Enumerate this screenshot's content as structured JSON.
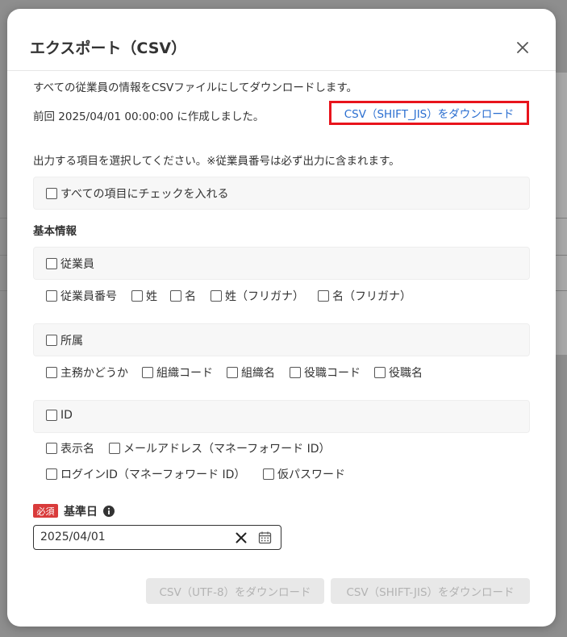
{
  "modal": {
    "title": "エクスポート（CSV）",
    "description": "すべての従業員の情報をCSVファイルにしてダウンロードします。",
    "previous": "前回 2025/04/01 00:00:00 に作成しました。",
    "previous_download_link": "CSV（SHIFT_JIS）をダウンロード",
    "select_instruction": "出力する項目を選択してください。※従業員番号は必ず出力に含まれます。"
  },
  "select_all": {
    "label": "すべての項目にチェックを入れる",
    "checked": false
  },
  "basic_info": {
    "heading": "基本情報",
    "groups": [
      {
        "label": "従業員",
        "items": [
          "従業員番号",
          "姓",
          "名",
          "姓（フリガナ）",
          "名（フリガナ）"
        ]
      },
      {
        "label": "所属",
        "items": [
          "主務かどうか",
          "組織コード",
          "組織名",
          "役職コード",
          "役職名"
        ]
      },
      {
        "label": "ID",
        "items": [
          "表示名",
          "メールアドレス（マネーフォワード ID）",
          "ログインID（マネーフォワード ID）",
          "仮パスワード"
        ]
      }
    ]
  },
  "reference_date": {
    "required_badge": "必須",
    "label": "基準日",
    "value": "2025/04/01"
  },
  "buttons": {
    "download_utf8": "CSV（UTF-8）をダウンロード",
    "download_sjis": "CSV（SHIFT-JIS）をダウンロード"
  },
  "colors": {
    "link": "#2a6ed0",
    "highlight_border": "#e8141c",
    "required_badge": "#d93b3b",
    "disabled_button_bg": "#e8e8e8",
    "disabled_button_text": "#b3b3b3"
  }
}
